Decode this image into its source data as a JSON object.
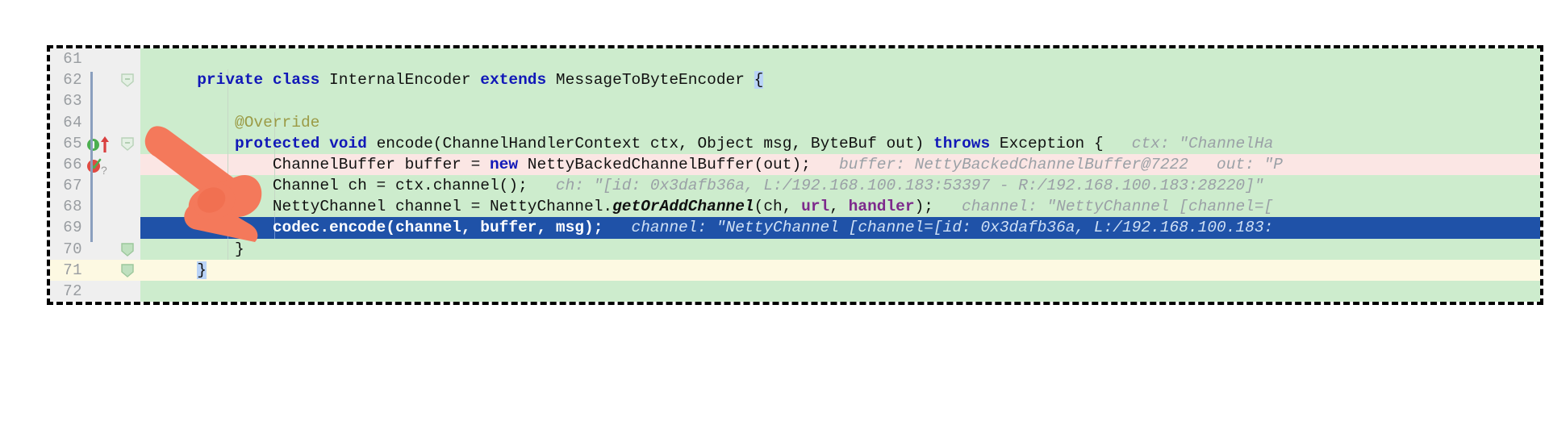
{
  "editor": {
    "language": "java",
    "colors": {
      "added_line_bg": "#cdeccd",
      "changed_line_bg": "#fbe6e4",
      "current_line_bg": "#1f52a8",
      "caret_row_gutter_bg": "#fdf9e2",
      "gutter_bg": "#efefef",
      "line_number_fg": "#999da1",
      "keyword_fg": "#1118b8",
      "annotation_fg": "#9b9b46",
      "field_fg": "#7d2a8c",
      "inlay_hint_fg": "#9aa0a6",
      "brace_match_bg": "#b9d3f7",
      "annotation_border": "#000000",
      "pointer_color": "#f4795b"
    },
    "lines": [
      {
        "number": "61",
        "bg": "added",
        "indent_guides": 0,
        "gutter_icons": [],
        "fold": "none",
        "tokens": []
      },
      {
        "number": "62",
        "bg": "added",
        "indent_guides": 1,
        "gutter_icons": [],
        "fold": "collapse-start",
        "tokens": [
          {
            "text": "      ",
            "style": "plain"
          },
          {
            "text": "private",
            "style": "kw"
          },
          {
            "text": " ",
            "style": "plain"
          },
          {
            "text": "class",
            "style": "kw"
          },
          {
            "text": " InternalEncoder ",
            "style": "plain"
          },
          {
            "text": "extends",
            "style": "kw"
          },
          {
            "text": " MessageToByteEncoder ",
            "style": "plain"
          },
          {
            "text": "{",
            "style": "brace-hl"
          }
        ]
      },
      {
        "number": "63",
        "bg": "added",
        "indent_guides": 1,
        "gutter_icons": [],
        "fold": "none",
        "tokens": []
      },
      {
        "number": "64",
        "bg": "added",
        "indent_guides": 2,
        "gutter_icons": [],
        "fold": "none",
        "tokens": [
          {
            "text": "          ",
            "style": "plain"
          },
          {
            "text": "@Override",
            "style": "anno"
          }
        ]
      },
      {
        "number": "65",
        "bg": "added",
        "indent_guides": 2,
        "gutter_icons": [
          "breakpoint-overridden-method-icon",
          "implementing-method-arrow-icon"
        ],
        "fold": "collapse-start",
        "tokens": [
          {
            "text": "          ",
            "style": "plain"
          },
          {
            "text": "protected",
            "style": "kw"
          },
          {
            "text": " ",
            "style": "plain"
          },
          {
            "text": "void",
            "style": "kw"
          },
          {
            "text": " encode(ChannelHandlerContext ctx, Object msg, ByteBuf out) ",
            "style": "plain"
          },
          {
            "text": "throws",
            "style": "kw"
          },
          {
            "text": " Exception {",
            "style": "plain"
          },
          {
            "text": "   ctx: \"ChannelHa",
            "style": "hint"
          }
        ]
      },
      {
        "number": "66",
        "bg": "changed",
        "indent_guides": 2,
        "gutter_icons": [
          "breakpoint-verified-icon",
          "question-mark-icon"
        ],
        "fold": "none",
        "tokens": [
          {
            "text": "              ",
            "style": "plain"
          },
          {
            "text": "ChannelBuffer buffer = ",
            "style": "plain"
          },
          {
            "text": "new",
            "style": "kw"
          },
          {
            "text": " NettyBackedChannelBuffer(out);",
            "style": "plain"
          },
          {
            "text": "   buffer: NettyBackedChannelBuffer@7222   out: \"P",
            "style": "hint"
          }
        ]
      },
      {
        "number": "67",
        "bg": "added",
        "indent_guides": 2,
        "gutter_icons": [],
        "fold": "none",
        "tokens": [
          {
            "text": "              ",
            "style": "plain"
          },
          {
            "text": "Channel ch = ctx.channel();",
            "style": "plain"
          },
          {
            "text": "   ch: \"[id: 0x3dafb36a, L:/192.168.100.183:53397 - R:/192.168.100.183:28220]\"",
            "style": "hint"
          }
        ]
      },
      {
        "number": "68",
        "bg": "added",
        "indent_guides": 2,
        "gutter_icons": [],
        "fold": "none",
        "tokens": [
          {
            "text": "              ",
            "style": "plain"
          },
          {
            "text": "NettyChannel channel = NettyChannel.",
            "style": "plain"
          },
          {
            "text": "getOrAddChannel",
            "style": "ident-it"
          },
          {
            "text": "(ch, ",
            "style": "plain"
          },
          {
            "text": "url",
            "style": "field"
          },
          {
            "text": ", ",
            "style": "plain"
          },
          {
            "text": "handler",
            "style": "field"
          },
          {
            "text": ");",
            "style": "plain"
          },
          {
            "text": "   channel: \"NettyChannel [channel=[",
            "style": "hint"
          }
        ]
      },
      {
        "number": "69",
        "bg": "current",
        "indent_guides": 2,
        "gutter_icons": [],
        "fold": "none",
        "tokens": [
          {
            "text": "              ",
            "style": "cur-text"
          },
          {
            "text": "codec.encode(channel, buffer, msg);",
            "style": "cur-text"
          },
          {
            "text": "   channel: \"NettyChannel [channel=[id: 0x3dafb36a, L:/192.168.100.183:",
            "style": "cur-hint"
          }
        ]
      },
      {
        "number": "70",
        "bg": "added",
        "indent_guides": 1,
        "gutter_icons": [],
        "fold": "collapse-end",
        "tokens": [
          {
            "text": "          ",
            "style": "plain"
          },
          {
            "text": "}",
            "style": "curly"
          }
        ]
      },
      {
        "number": "71",
        "bg": "yellow",
        "indent_guides": 0,
        "gutter_icons": [],
        "fold": "collapse-end",
        "tokens": [
          {
            "text": "      ",
            "style": "plain"
          },
          {
            "text": "}",
            "style": "brace-hl"
          }
        ]
      },
      {
        "number": "72",
        "bg": "added",
        "indent_guides": 0,
        "gutter_icons": [],
        "fold": "none",
        "tokens": []
      }
    ]
  },
  "annotations": {
    "frame_label": "dashed-highlight-region",
    "pointer_label": "orange-arrow-pointer",
    "pointer_target_line": "69"
  }
}
